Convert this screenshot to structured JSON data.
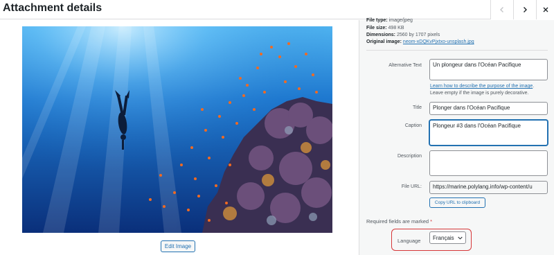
{
  "header": {
    "title": "Attachment details",
    "prev_icon": "chevron-left-icon",
    "next_icon": "chevron-right-icon",
    "close_icon": "close-icon"
  },
  "image": {
    "description": "Underwater scene: a freediver descending near a coral reef surrounded by orange fish",
    "edit_label": "Edit Image"
  },
  "meta": {
    "file_type_label": "File type:",
    "file_type": "image/jpeg",
    "file_size_label": "File size:",
    "file_size": "498 KB",
    "dimensions_label": "Dimensions:",
    "dimensions": "2560 by 1707 pixels",
    "original_label": "Original image:",
    "original": "neom-xDQKvPjxtxo-unsplash.jpg"
  },
  "fields": {
    "alt_label": "Alternative Text",
    "alt_value": "Un plongeur dans l'Océan Pacifique",
    "alt_help_link": "Learn how to describe the purpose of the image",
    "alt_help_end": ".",
    "alt_help_2": "Leave empty if the image is purely decorative.",
    "title_label": "Title",
    "title_value": "Plonger dans l'Océan Pacifique",
    "caption_label": "Caption",
    "caption_value": "Plongeur #3 dans l'Océan Pacifique",
    "description_label": "Description",
    "description_value": "",
    "url_label": "File URL:",
    "url_value": "https://marine.polylang.info/wp-content/u",
    "copy_label": "Copy URL to clipboard"
  },
  "required": {
    "text": "Required fields are marked",
    "star": "*"
  },
  "language": {
    "label": "Language",
    "selected": "Français"
  },
  "colors": {
    "accent": "#2271b1",
    "highlight": "#d63638",
    "sidebar_bg": "#f6f7f7"
  }
}
